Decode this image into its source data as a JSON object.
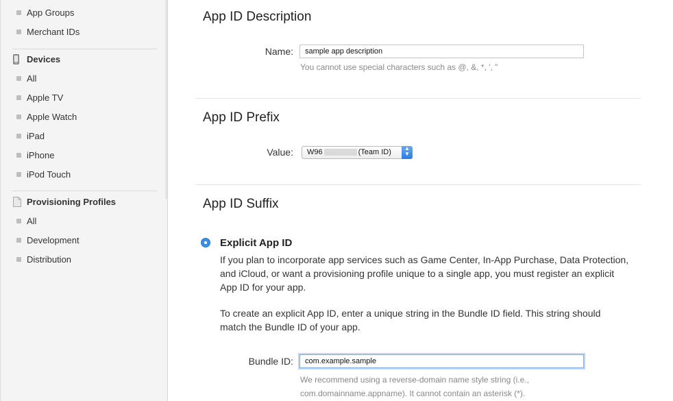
{
  "sidebar": {
    "identifiers": {
      "items": [
        {
          "label": "App Groups"
        },
        {
          "label": "Merchant IDs"
        }
      ]
    },
    "devices": {
      "heading": "Devices",
      "items": [
        {
          "label": "All"
        },
        {
          "label": "Apple TV"
        },
        {
          "label": "Apple Watch"
        },
        {
          "label": "iPad"
        },
        {
          "label": "iPhone"
        },
        {
          "label": "iPod Touch"
        }
      ]
    },
    "profiles": {
      "heading": "Provisioning Profiles",
      "items": [
        {
          "label": "All"
        },
        {
          "label": "Development"
        },
        {
          "label": "Distribution"
        }
      ]
    }
  },
  "description_section": {
    "title": "App ID Description",
    "name_label": "Name:",
    "name_value": "sample app description",
    "hint": "You cannot use special characters such as @, &, *, ', \""
  },
  "prefix_section": {
    "title": "App ID Prefix",
    "value_label": "Value:",
    "selected_prefix": "W96",
    "selected_suffix": "(Team ID)"
  },
  "suffix_section": {
    "title": "App ID Suffix",
    "option_title": "Explicit App ID",
    "para1": "If you plan to incorporate app services such as Game Center, In-App Purchase, Data Protection, and iCloud, or want a provisioning profile unique to a single app, you must register an explicit App ID for your app.",
    "para2": "To create an explicit App ID, enter a unique string in the Bundle ID field. This string should match the Bundle ID of your app.",
    "bundle_label": "Bundle ID:",
    "bundle_value": "com.example.sample",
    "bundle_hint": "We recommend using a reverse-domain name style string (i.e., com.domainname.appname). It cannot contain an asterisk (*)."
  },
  "colors": {
    "accent": "#3a8ee6",
    "sidebar_bg": "#f4f4f4"
  }
}
